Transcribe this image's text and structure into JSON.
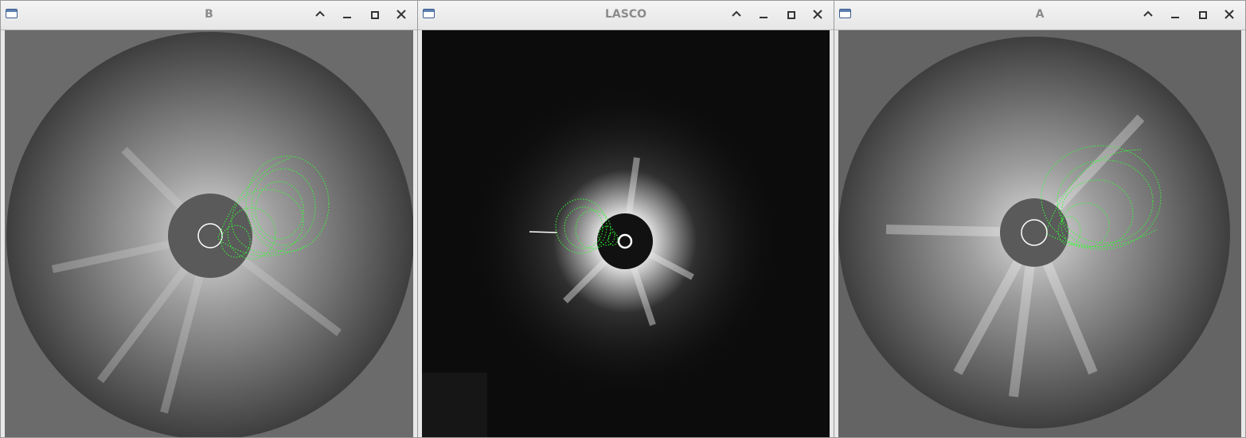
{
  "windows": [
    {
      "id": "B",
      "title": "B"
    },
    {
      "id": "LASCO",
      "title": "LASCO"
    },
    {
      "id": "A",
      "title": "A"
    }
  ],
  "window_controls": [
    "shade-icon",
    "minimize-icon",
    "maximize-icon",
    "close-icon"
  ],
  "colors": {
    "overlay_mesh": "#33ff33",
    "occulter": "#5a5a5a",
    "lasco_background": "#0c0c0c",
    "stereo_background": "#646464"
  }
}
